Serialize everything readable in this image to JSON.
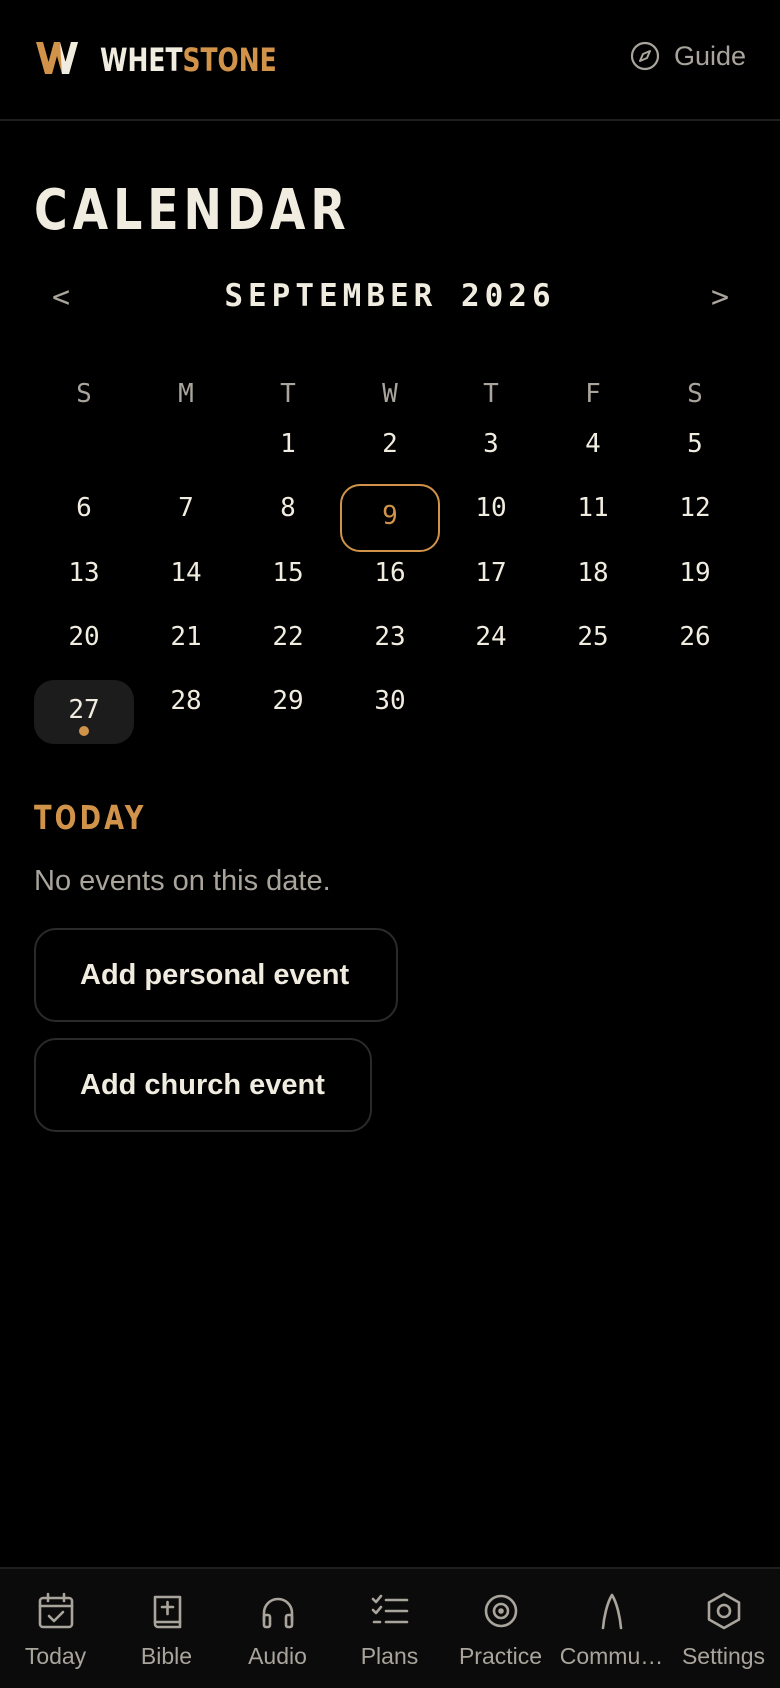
{
  "app": {
    "brand_first": "WHET",
    "brand_second": "STONE",
    "guide_label": "Guide"
  },
  "colors": {
    "accent": "#d1924a",
    "text": "#f1ece0",
    "muted": "#a9a59c",
    "background": "#000000"
  },
  "icons": {
    "logo": "whetstone-w-logo",
    "guide": "compass-icon"
  },
  "calendar": {
    "title": "CALENDAR",
    "month_label": "SEPTEMBER 2026",
    "prev_label": "<",
    "next_label": ">",
    "weekdays": [
      "S",
      "M",
      "T",
      "W",
      "T",
      "F",
      "S"
    ],
    "days": [
      "1",
      "2",
      "3",
      "4",
      "5",
      "6",
      "7",
      "8",
      "9",
      "10",
      "11",
      "12",
      "13",
      "14",
      "15",
      "16",
      "17",
      "18",
      "19",
      "20",
      "21",
      "22",
      "23",
      "24",
      "25",
      "26",
      "27",
      "28",
      "29",
      "30"
    ],
    "selected_day": "9",
    "today_day": "27",
    "days_with_events": [
      "27"
    ]
  },
  "events": {
    "heading": "TODAY",
    "empty_text": "No events on this date.",
    "add_personal": "Add personal event",
    "add_church": "Add church event"
  },
  "tabs": [
    {
      "label": "Today",
      "icon": "calendar-check-icon"
    },
    {
      "label": "Bible",
      "icon": "bible-icon"
    },
    {
      "label": "Audio",
      "icon": "headphones-icon"
    },
    {
      "label": "Plans",
      "icon": "checklist-icon"
    },
    {
      "label": "Practice",
      "icon": "target-icon"
    },
    {
      "label": "Commu…",
      "icon": "steeple-icon"
    },
    {
      "label": "Settings",
      "icon": "hexagon-settings-icon"
    }
  ]
}
